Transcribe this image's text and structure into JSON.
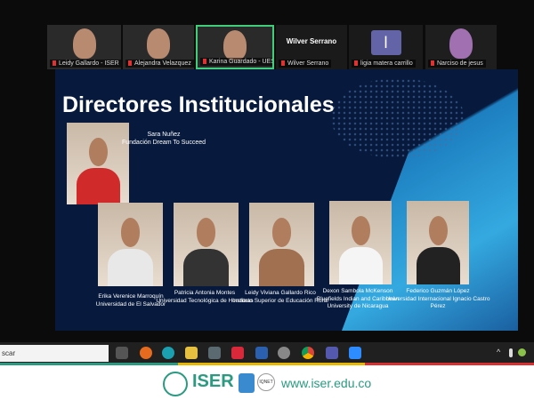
{
  "participants": [
    {
      "name": "Leidy Gallardo - ISER"
    },
    {
      "name": "Alejandra Velazquez"
    },
    {
      "name": "Karina Guardado - UES",
      "active": true
    },
    {
      "name": "Wilver Serrano",
      "display": "Wilver Serrano"
    },
    {
      "name": "ligia matera carrillo",
      "initial": "l"
    },
    {
      "name": "Narciso de jesus"
    }
  ],
  "slide": {
    "title": "Directores Institucionales",
    "featured": {
      "name": "Sara Nuñez",
      "org": "Fundación Dream To Succeed"
    },
    "people": [
      {
        "name": "Erika Verenice Marroquín",
        "org": "Universidad de El Salvador"
      },
      {
        "name": "Patricia Antonia Montes",
        "org": "Universidad Tecnológica de Honduras"
      },
      {
        "name": "Leidy Viviana Gallardo Rico",
        "org": "Instituto Superior de Educación Rural"
      },
      {
        "name": "Dexon Sambola McKenson",
        "org": "Bluefields Indian and Caribbean University de Nicaragua"
      },
      {
        "name": "Federico Guzmán López",
        "org": "Universidad Internacional Ignacio Castro Pérez"
      }
    ]
  },
  "taskbar": {
    "search_text": "scar",
    "icons": [
      "task-view",
      "firefox",
      "edge",
      "file-explorer",
      "calculator",
      "wps-office",
      "word",
      "inkscape",
      "chrome",
      "teams",
      "zoom"
    ]
  },
  "footer": {
    "brand": "ISER",
    "cert": "IQNET",
    "url": "www.iser.edu.co"
  },
  "colors": {
    "accent_green": "#2a9a80",
    "active_border": "#3fcf7a",
    "slide_bg": "#071a3d"
  }
}
